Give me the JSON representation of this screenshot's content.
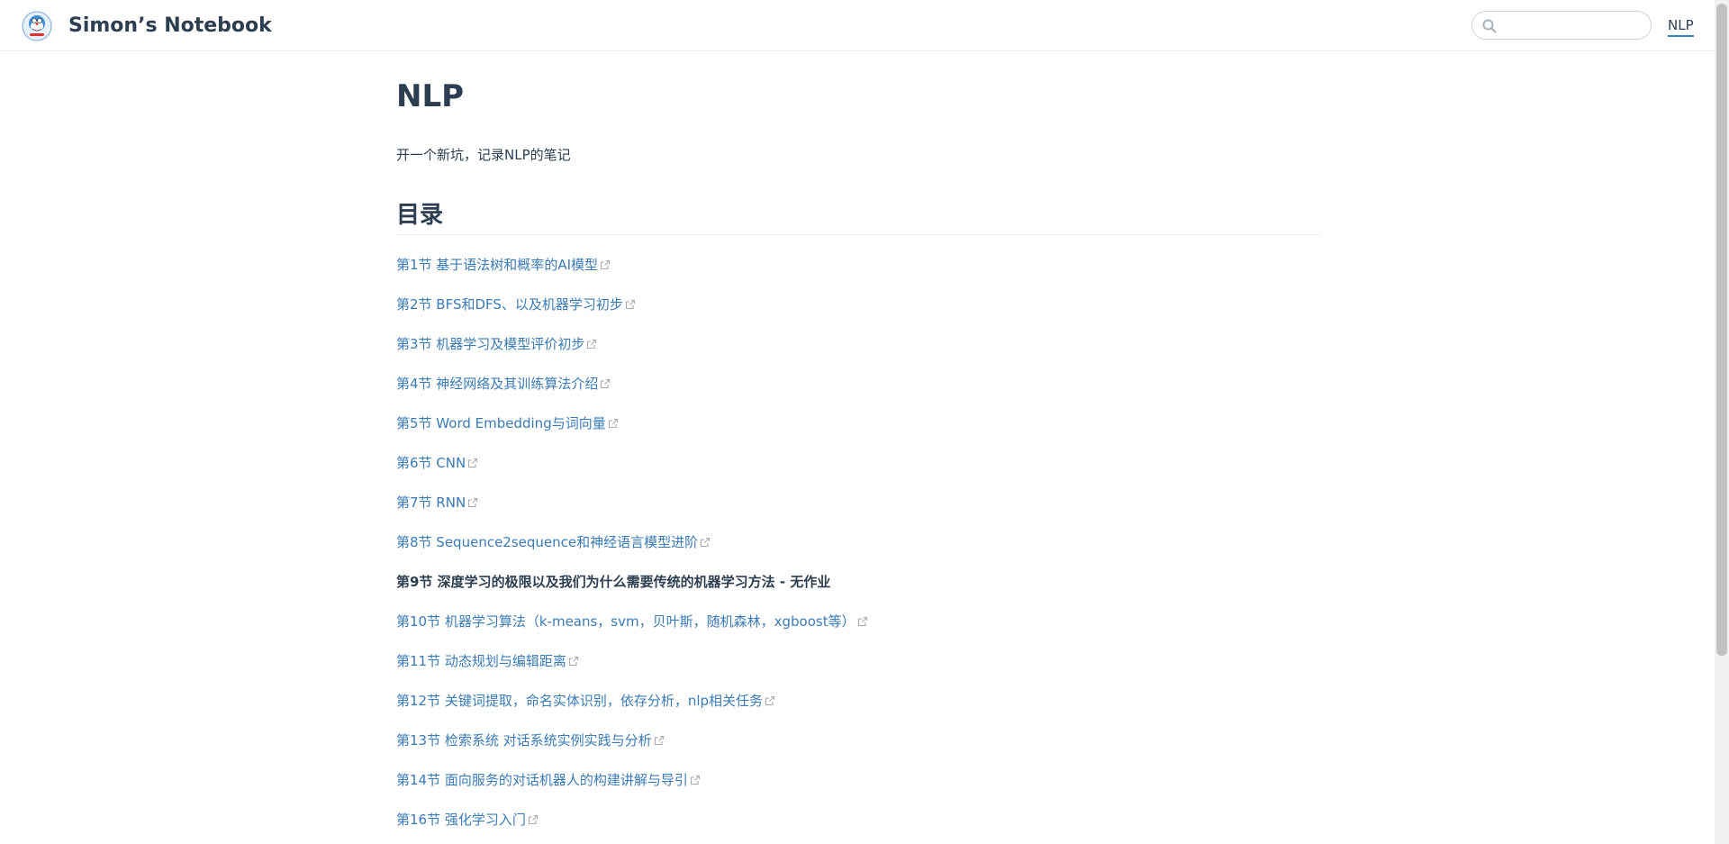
{
  "header": {
    "site_name": "Simon’s Notebook",
    "search": {
      "placeholder": "",
      "value": ""
    },
    "nav_link": "NLP"
  },
  "page": {
    "title": "NLP",
    "intro": "开一个新坑，记录NLP的笔记",
    "toc_heading": "目录"
  },
  "toc": [
    {
      "label": "第1节 基于语法树和概率的AI模型",
      "link": true
    },
    {
      "label": "第2节 BFS和DFS、以及机器学习初步",
      "link": true
    },
    {
      "label": "第3节 机器学习及模型评价初步",
      "link": true
    },
    {
      "label": "第4节 神经网络及其训练算法介绍",
      "link": true
    },
    {
      "label": "第5节 Word Embedding与词向量",
      "link": true
    },
    {
      "label": "第6节 CNN",
      "link": true
    },
    {
      "label": "第7节 RNN",
      "link": true
    },
    {
      "label": "第8节 Sequence2sequence和神经语言模型进阶",
      "link": true
    },
    {
      "label": "第9节 深度学习的极限以及我们为什么需要传统的机器学习方法 - 无作业",
      "link": false
    },
    {
      "label": "第10节 机器学习算法（k-means，svm，贝叶斯，随机森林，xgboost等）",
      "link": true
    },
    {
      "label": "第11节 动态规划与编辑距离",
      "link": true
    },
    {
      "label": "第12节 关键词提取，命名实体识别，依存分析，nlp相关任务",
      "link": true
    },
    {
      "label": "第13节 检索系统 对话系统实例实践与分析",
      "link": true
    },
    {
      "label": "第14节 面向服务的对话机器人的构建讲解与导引",
      "link": true
    },
    {
      "label": "第16节 强化学习入门",
      "link": true
    }
  ],
  "colors": {
    "link": "#3a7bb5",
    "text": "#2c3e50",
    "accent": "#3385c6"
  },
  "icons": {
    "logo": "robot-cat-avatar",
    "search": "search-icon",
    "external": "external-link-icon"
  }
}
